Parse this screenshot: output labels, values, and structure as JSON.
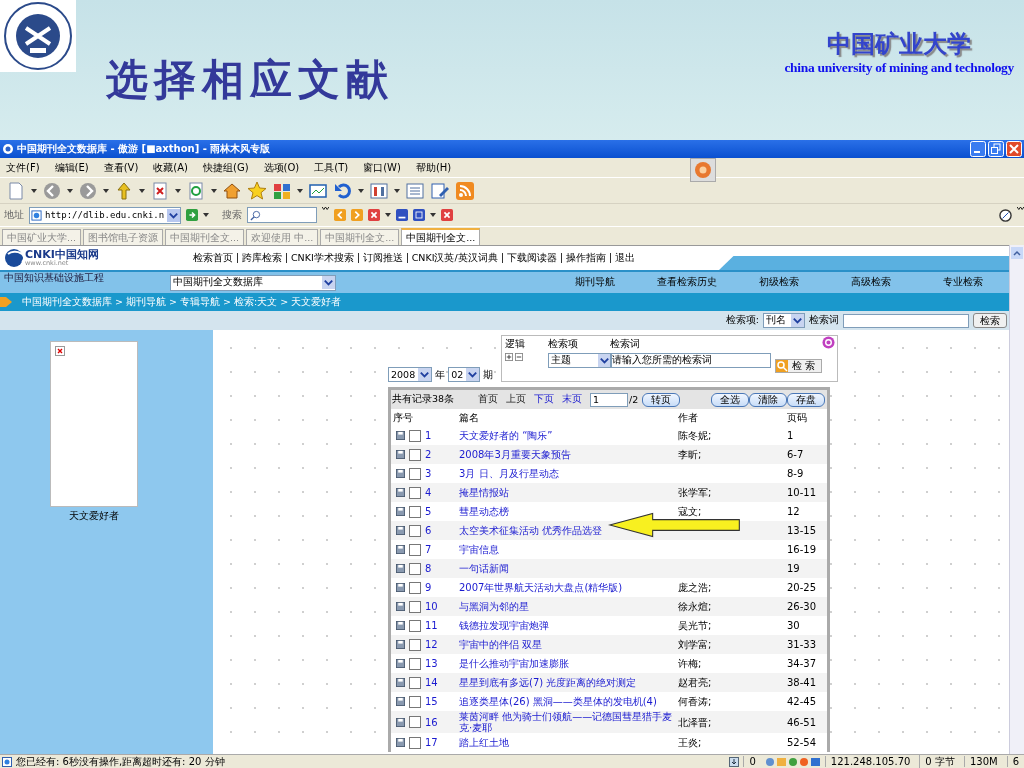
{
  "slide": {
    "title": "选择相应文献",
    "university_name": "中国矿业大学",
    "university_name_en": "china university of mining and technology"
  },
  "browser": {
    "title": "中国期刊全文数据库 - 傲游 [■axthon] - 雨林木风专版",
    "menus": [
      "文件(F)",
      "编辑(E)",
      "查看(V)",
      "收藏(A)",
      "快捷组(G)",
      "选项(O)",
      "工具(T)",
      "窗口(W)",
      "帮助(H)"
    ],
    "address_label": "地址",
    "address": "http://dlib.edu.cnki.n",
    "search_label": "搜索",
    "tabs": [
      {
        "label": "中国矿业大学...",
        "selected": false
      },
      {
        "label": "图书馆电子资源",
        "selected": false
      },
      {
        "label": "中国期刊全文...",
        "selected": false
      },
      {
        "label": "欢迎使用 中...",
        "selected": false
      },
      {
        "label": "中国期刊全文...",
        "selected": false
      },
      {
        "label": "中国期刊全文...",
        "selected": true
      }
    ],
    "status": {
      "message": "您已经有: 6秒没有操作,距离超时还有: 20 分钟",
      "counter": "0",
      "fields": [
        "121.248.105.70",
        "0 字节",
        "130M",
        "6"
      ]
    }
  },
  "site": {
    "logo": "CNKI中国知网",
    "logo_url": "www.cnki.net",
    "slogan": "中国知识基础设施工程",
    "nav_links": [
      "检索首页",
      "跨库检索",
      "CNKI学术搜索",
      "订阅推送",
      "CNKI汉英/英汉词典",
      "下载阅读器",
      "操作指南",
      "退出"
    ],
    "database": "中国期刊全文数据库",
    "nav_tabs": [
      "期刊导航",
      "查看检索历史",
      "初级检索",
      "高级检索",
      "专业检索"
    ],
    "breadcrumb": "中国期刊全文数据库 > 期刊导航 > 专辑导航 > 检索:天文 > 天文爱好者",
    "quick_search": {
      "field_label": "检索项:",
      "field": "刊名",
      "term_label": "检索词",
      "button": "检索"
    },
    "sidebar": {
      "caption": "天文爱好者"
    },
    "filters": {
      "year": "2008",
      "year_unit": "年",
      "issue": "02",
      "issue_unit": "期"
    },
    "query": {
      "logic_label": "逻辑",
      "field_label": "检索项",
      "term_label": "检索词",
      "field": "主题",
      "term": "请输入您所需的检索词",
      "button": "检 索"
    },
    "results": {
      "count": "共有记录38条",
      "pager": [
        {
          "label": "首页",
          "disabled": true
        },
        {
          "label": "上页",
          "disabled": true
        },
        {
          "label": "下页",
          "disabled": false
        },
        {
          "label": "末页",
          "disabled": false
        }
      ],
      "page": "1",
      "page_total": "/2",
      "go_button": "转页",
      "buttons": [
        "全选",
        "清除",
        "存盘"
      ],
      "columns": [
        "序号",
        "篇名",
        "作者",
        "页码"
      ],
      "rows": [
        {
          "no": "1",
          "title": "天文爱好者的 “陶乐”",
          "author": "陈冬妮;",
          "pages": "1",
          "checked": false
        },
        {
          "no": "2",
          "title": "2008年3月重要天象预告",
          "author": "李昕;",
          "pages": "6-7",
          "checked": false
        },
        {
          "no": "3",
          "title": "3月  日、月及行星动态",
          "author": "",
          "pages": "8-9",
          "checked": false
        },
        {
          "no": "4",
          "title": "掩星情报站",
          "author": "张学军;",
          "pages": "10-11",
          "checked": false
        },
        {
          "no": "5",
          "title": "彗星动态榜",
          "author": "寇文;",
          "pages": "12",
          "checked": false
        },
        {
          "no": "6",
          "title": "太空美术征集活动  优秀作品选登",
          "author": "",
          "pages": "13-15",
          "checked": false
        },
        {
          "no": "7",
          "title": "宇宙信息",
          "author": "",
          "pages": "16-19",
          "checked": false
        },
        {
          "no": "8",
          "title": "一句话新闻",
          "author": "",
          "pages": "19",
          "checked": false
        },
        {
          "no": "9",
          "title": "2007年世界航天活动大盘点(精华版)",
          "author": "庞之浩;",
          "pages": "20-25",
          "checked": false
        },
        {
          "no": "10",
          "title": "与黑洞为邻的星",
          "author": "徐永煊;",
          "pages": "26-30",
          "checked": false
        },
        {
          "no": "11",
          "title": "钱德拉发现宇宙炮弹",
          "author": "吴光节;",
          "pages": "30",
          "checked": false
        },
        {
          "no": "12",
          "title": "宇宙中的伴侣  双星",
          "author": "刘学富;",
          "pages": "31-33",
          "checked": false
        },
        {
          "no": "13",
          "title": "是什么推动宇宙加速膨胀",
          "author": "许梅;",
          "pages": "34-37",
          "checked": false
        },
        {
          "no": "14",
          "title": "星星到底有多远(7) 光度距离的绝对测定",
          "author": "赵君亮;",
          "pages": "38-41",
          "checked": false
        },
        {
          "no": "15",
          "title": "追逐类星体(26) 黑洞——类星体的发电机(4)",
          "author": "何香涛;",
          "pages": "42-45",
          "checked": false
        },
        {
          "no": "16",
          "title": "莱茵河畔  他为骑士们领航——记德国彗星猎手麦克·麦耶",
          "author": "北泽晋;",
          "pages": "46-51",
          "checked": false
        },
        {
          "no": "17",
          "title": "踏上红土地",
          "author": "王炎;",
          "pages": "52-54",
          "checked": false
        }
      ]
    }
  }
}
